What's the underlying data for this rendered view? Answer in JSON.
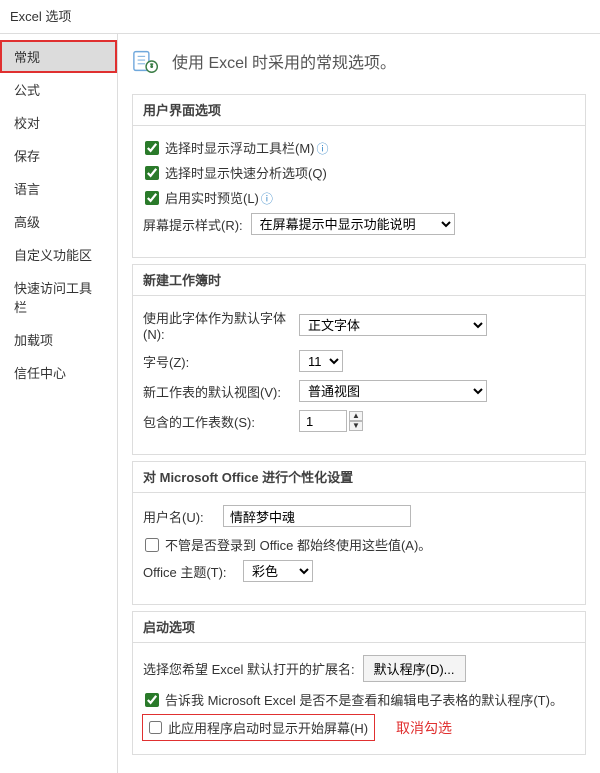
{
  "title": "Excel 选项",
  "sidebar": {
    "items": [
      {
        "label": "常规"
      },
      {
        "label": "公式"
      },
      {
        "label": "校对"
      },
      {
        "label": "保存"
      },
      {
        "label": "语言"
      },
      {
        "label": "高级"
      },
      {
        "label": "自定义功能区"
      },
      {
        "label": "快速访问工具栏"
      },
      {
        "label": "加载项"
      },
      {
        "label": "信任中心"
      }
    ],
    "active_index": 0
  },
  "header": {
    "subtitle": "使用 Excel 时采用的常规选项。"
  },
  "ui_section": {
    "title": "用户界面选项",
    "show_mini_toolbar": "选择时显示浮动工具栏(M)",
    "show_quick_analysis": "选择时显示快速分析选项(Q)",
    "enable_live_preview": "启用实时预览(L)",
    "screen_tip_label": "屏幕提示样式(R):",
    "screen_tip_value": "在屏幕提示中显示功能说明"
  },
  "new_workbook": {
    "title": "新建工作簿时",
    "font_label": "使用此字体作为默认字体(N):",
    "font_value": "正文字体",
    "size_label": "字号(Z):",
    "size_value": "11",
    "view_label": "新工作表的默认视图(V):",
    "view_value": "普通视图",
    "sheets_label": "包含的工作表数(S):",
    "sheets_value": "1"
  },
  "personalize": {
    "title": "对 Microsoft Office 进行个性化设置",
    "username_label": "用户名(U):",
    "username_value": "情醉梦中魂",
    "always_use": "不管是否登录到 Office 都始终使用这些值(A)。",
    "theme_label": "Office 主题(T):",
    "theme_value": "彩色"
  },
  "startup": {
    "title": "启动选项",
    "ext_label": "选择您希望 Excel 默认打开的扩展名:",
    "ext_button": "默认程序(D)...",
    "tell_me": "告诉我 Microsoft Excel 是否不是查看和编辑电子表格的默认程序(T)。",
    "show_start": "此应用程序启动时显示开始屏幕(H)"
  },
  "annotation": "取消勾选"
}
